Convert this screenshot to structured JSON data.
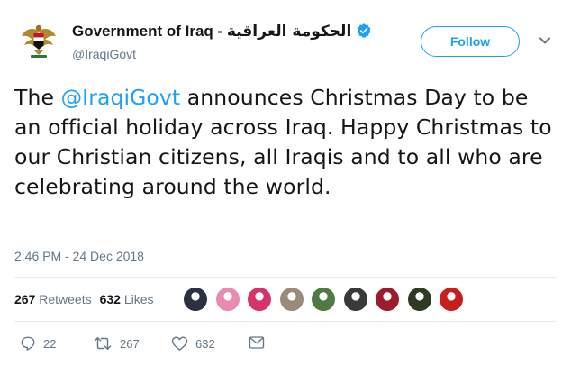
{
  "account": {
    "name_en": "Government of Iraq - ",
    "name_ar": "الحكومة العراقية",
    "handle": "@IraqiGovt",
    "verified": true,
    "avatar_icon": "iraq-eagle-emblem"
  },
  "header": {
    "follow_label": "Follow"
  },
  "tweet": {
    "text_before": "The ",
    "mention": "@IraqiGovt",
    "text_after": " announces Christmas Day to be an official holiday across Iraq. Happy Christmas to our Christian citizens, all Iraqis and to all who are celebrating around the world.",
    "timestamp": "2:46 PM - 24 Dec 2018"
  },
  "stats": {
    "retweets_count": "267",
    "retweets_label": "Retweets",
    "likes_count": "632",
    "likes_label": "Likes",
    "liker_avatars": [
      "#2b3140",
      "#e98ab0",
      "#d6336c",
      "#9a8a78",
      "#4f7a45",
      "#3a3a3a",
      "#9b1c2c",
      "#2f3a24",
      "#c81e1e"
    ]
  },
  "actions": {
    "replies": "22",
    "retweets": "267",
    "likes": "632"
  },
  "colors": {
    "accent": "#1da1f2",
    "secondary_text": "#657786",
    "divider": "#e6ecf0"
  }
}
